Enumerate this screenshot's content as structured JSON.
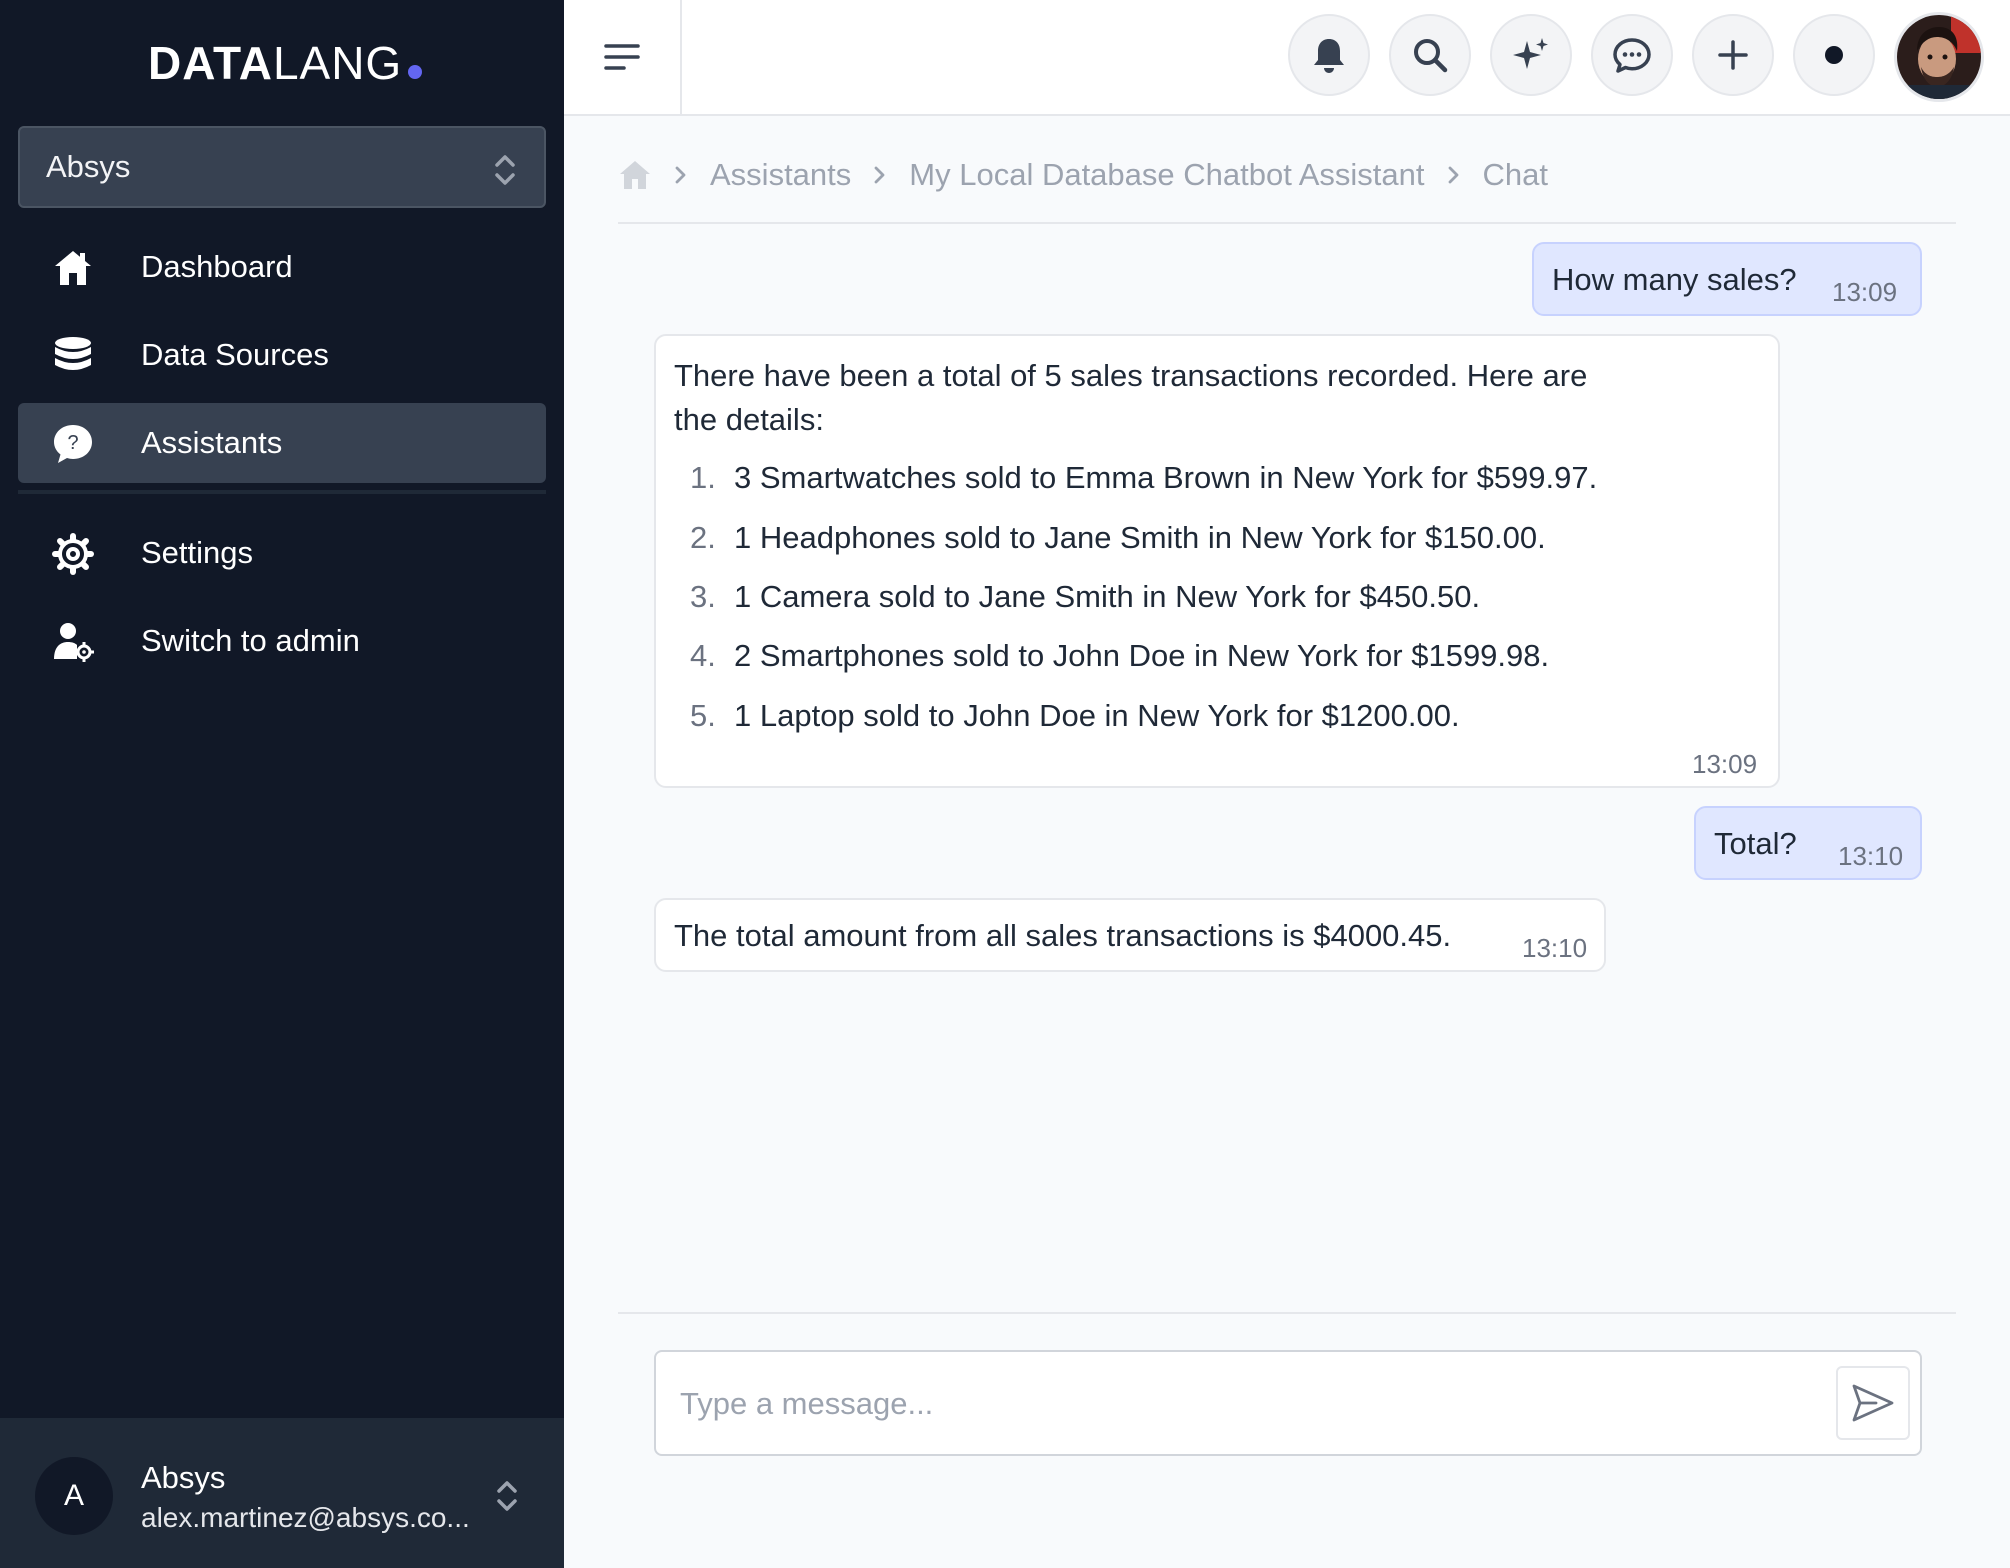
{
  "sidebar": {
    "logo": {
      "bold": "DATA",
      "light": "LANG"
    },
    "org_select": {
      "value": "Absys"
    },
    "nav": [
      {
        "label": "Dashboard",
        "icon": "home-icon"
      },
      {
        "label": "Data Sources",
        "icon": "database-icon"
      },
      {
        "label": "Assistants",
        "icon": "help-bubble-icon",
        "active": true
      },
      {
        "label": "Settings",
        "icon": "gear-icon"
      },
      {
        "label": "Switch to admin",
        "icon": "user-cog-icon"
      }
    ],
    "user": {
      "initial": "A",
      "name": "Absys",
      "email": "alex.martinez@absys.co..."
    }
  },
  "header": {
    "buttons": [
      "bell-icon",
      "search-icon",
      "sparkles-icon",
      "chat-icon",
      "plus-icon",
      "dot-icon"
    ]
  },
  "breadcrumb": {
    "items": [
      "Assistants",
      "My Local Database Chatbot Assistant",
      "Chat"
    ]
  },
  "chat": {
    "messages": [
      {
        "role": "user",
        "text": "How many sales?",
        "time": "13:09"
      },
      {
        "role": "assistant",
        "intro_line1": "There have been a total of 5 sales transactions recorded. Here are",
        "intro_line2": "the details:",
        "items": [
          "3 Smartwatches sold to Emma Brown in New York for $599.97.",
          "1 Headphones sold to Jane Smith in New York for $150.00.",
          "1 Camera sold to Jane Smith in New York for $450.50.",
          "2 Smartphones sold to John Doe in New York for $1599.98.",
          "1 Laptop sold to John Doe in New York for $1200.00."
        ],
        "time": "13:09"
      },
      {
        "role": "user",
        "text": "Total?",
        "time": "13:10"
      },
      {
        "role": "assistant",
        "text": "The total amount from all sales transactions is $4000.45.",
        "time": "13:10"
      }
    ]
  },
  "composer": {
    "placeholder": "Type a message...",
    "value": ""
  },
  "colors": {
    "sidebar_bg": "#111827",
    "accent": "#6366f1",
    "user_bubble": "#e0e7ff"
  }
}
